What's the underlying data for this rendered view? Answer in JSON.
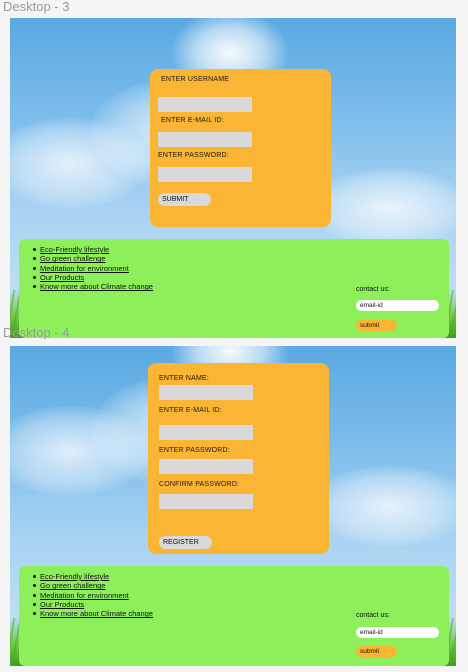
{
  "frames": {
    "desktop3": {
      "label": "Desktop - 3",
      "form": {
        "username_label": "ENTER USERNAME",
        "email_label": "ENTER E-MAIL ID:",
        "password_label": "ENTER PASSWORD:",
        "submit_label": "SUBMIT"
      },
      "footer": {
        "links": [
          "Eco-Friendly lifestyle",
          "Go green challenge",
          "Meditation for environment",
          "Our Products",
          "Know more about Climate change"
        ],
        "contact_label": "contact us:",
        "email_text": "email-id",
        "submit_label": "submit"
      }
    },
    "desktop4": {
      "label": "Desktop - 4",
      "form": {
        "name_label": "ENTER NAME:",
        "email_label": "ENTER E-MAIL ID:",
        "password_label": "ENTER PASSWORD:",
        "confirm_label": "CONFIRM PASSWORD:",
        "register_label": "REGISTER"
      },
      "footer": {
        "links": [
          "Eco-Friendly lifestyle",
          "Go green challenge",
          "Meditation for environment",
          "Our Products",
          "Know more about Climate change"
        ],
        "contact_label": "contact us:",
        "email_text": "email-id",
        "submit_label": "submit"
      }
    }
  },
  "colors": {
    "form_card": "#fbb534",
    "footer": "#8df05b",
    "input": "#d9d9d9",
    "sky": "#5aa9e2"
  }
}
